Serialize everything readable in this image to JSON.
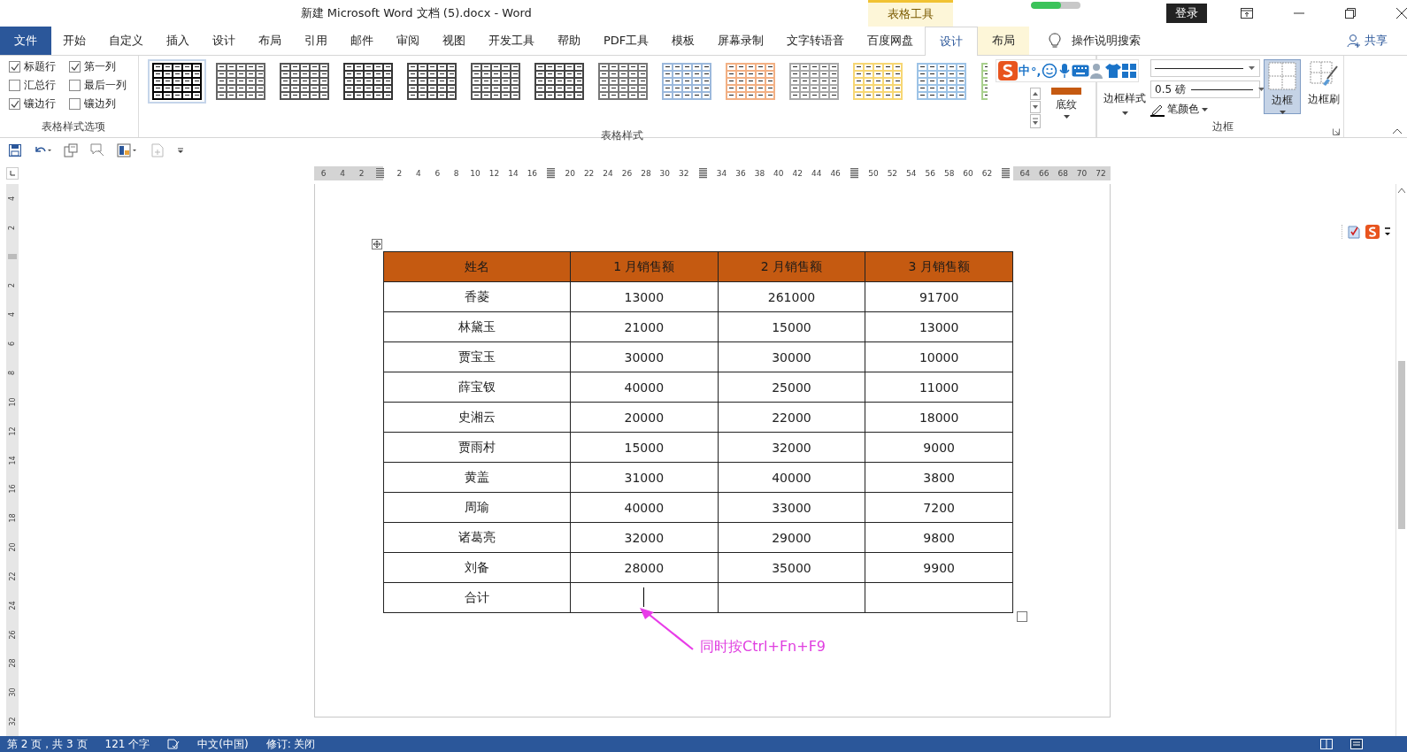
{
  "window": {
    "title": "新建 Microsoft Word 文档 (5).docx  -  Word",
    "context_group": "表格工具",
    "sync_progress": {
      "level": 0.6
    },
    "sign_in": "登录"
  },
  "ribbon_tabs": [
    {
      "label": "文件",
      "kind": "file",
      "selected": false
    },
    {
      "label": "开始",
      "kind": "normal",
      "selected": false
    },
    {
      "label": "自定义",
      "kind": "normal",
      "selected": false
    },
    {
      "label": "插入",
      "kind": "normal",
      "selected": false
    },
    {
      "label": "设计",
      "kind": "normal",
      "selected": false
    },
    {
      "label": "布局",
      "kind": "normal",
      "selected": false
    },
    {
      "label": "引用",
      "kind": "normal",
      "selected": false
    },
    {
      "label": "邮件",
      "kind": "normal",
      "selected": false
    },
    {
      "label": "审阅",
      "kind": "normal",
      "selected": false
    },
    {
      "label": "视图",
      "kind": "normal",
      "selected": false
    },
    {
      "label": "开发工具",
      "kind": "normal",
      "selected": false
    },
    {
      "label": "帮助",
      "kind": "normal",
      "selected": false
    },
    {
      "label": "PDF工具",
      "kind": "normal",
      "selected": false
    },
    {
      "label": "模板",
      "kind": "normal",
      "selected": false
    },
    {
      "label": "屏幕录制",
      "kind": "normal",
      "selected": false
    },
    {
      "label": "文字转语音",
      "kind": "normal",
      "selected": false
    },
    {
      "label": "百度网盘",
      "kind": "normal",
      "selected": false
    },
    {
      "label": "设计",
      "kind": "context",
      "selected": true
    },
    {
      "label": "布局",
      "kind": "context",
      "selected": false
    }
  ],
  "tell_me": "操作说明搜索",
  "share": "共享",
  "style_options": {
    "title": "表格样式选项",
    "options": [
      {
        "label": "标题行",
        "checked": true
      },
      {
        "label": "第一列",
        "checked": true
      },
      {
        "label": "汇总行",
        "checked": false
      },
      {
        "label": "最后一列",
        "checked": false
      },
      {
        "label": "镶边行",
        "checked": true
      },
      {
        "label": "镶边列",
        "checked": false
      }
    ]
  },
  "table_styles": {
    "title": "表格样式",
    "styles": [
      {
        "color": "#000000",
        "selected": true
      },
      {
        "color": "#666666",
        "selected": false
      },
      {
        "color": "#555555",
        "selected": false
      },
      {
        "color": "#333333",
        "selected": false
      },
      {
        "color": "#444444",
        "selected": false
      },
      {
        "color": "#555555",
        "selected": false
      },
      {
        "color": "#444444",
        "selected": false
      },
      {
        "color": "#777777",
        "selected": false
      },
      {
        "color": "#9cb9dc",
        "selected": false
      },
      {
        "color": "#f2b084",
        "selected": false
      },
      {
        "color": "#aaaaaa",
        "selected": false
      },
      {
        "color": "#f7d774",
        "selected": false
      },
      {
        "color": "#9dc3e6",
        "selected": false
      },
      {
        "color": "#a9d08e",
        "selected": false
      }
    ]
  },
  "shading": {
    "label": "底纹",
    "color": "#c55a11"
  },
  "borders": {
    "title": "边框",
    "border_styles": "边框样式",
    "pen_weight": "0.5 磅",
    "pen_color": "笔颜色",
    "border": {
      "label": "边框",
      "selected": true
    },
    "border_painter": "边框刷"
  },
  "ime_toolbar": {
    "mode": "中",
    "punctuation": "°,"
  },
  "ruler": {
    "horizontal": [
      {
        "kind": "num",
        "label": "6"
      },
      {
        "kind": "num",
        "label": "4"
      },
      {
        "kind": "num",
        "label": "2"
      },
      {
        "kind": "marker"
      },
      {
        "kind": "num",
        "label": "2"
      },
      {
        "kind": "num",
        "label": "4"
      },
      {
        "kind": "num",
        "label": "6"
      },
      {
        "kind": "num",
        "label": "8"
      },
      {
        "kind": "num",
        "label": "10"
      },
      {
        "kind": "num",
        "label": "12"
      },
      {
        "kind": "num",
        "label": "14"
      },
      {
        "kind": "num",
        "label": "16"
      },
      {
        "kind": "marker"
      },
      {
        "kind": "num",
        "label": "20"
      },
      {
        "kind": "num",
        "label": "22"
      },
      {
        "kind": "num",
        "label": "24"
      },
      {
        "kind": "num",
        "label": "26"
      },
      {
        "kind": "num",
        "label": "28"
      },
      {
        "kind": "num",
        "label": "30"
      },
      {
        "kind": "num",
        "label": "32"
      },
      {
        "kind": "marker"
      },
      {
        "kind": "num",
        "label": "34"
      },
      {
        "kind": "num",
        "label": "36"
      },
      {
        "kind": "num",
        "label": "38"
      },
      {
        "kind": "num",
        "label": "40"
      },
      {
        "kind": "num",
        "label": "42"
      },
      {
        "kind": "num",
        "label": "44"
      },
      {
        "kind": "num",
        "label": "46"
      },
      {
        "kind": "marker"
      },
      {
        "kind": "num",
        "label": "50"
      },
      {
        "kind": "num",
        "label": "52"
      },
      {
        "kind": "num",
        "label": "54"
      },
      {
        "kind": "num",
        "label": "56"
      },
      {
        "kind": "num",
        "label": "58"
      },
      {
        "kind": "num",
        "label": "60"
      },
      {
        "kind": "num",
        "label": "62"
      },
      {
        "kind": "marker"
      },
      {
        "kind": "num",
        "label": "64"
      },
      {
        "kind": "num",
        "label": "66"
      },
      {
        "kind": "num",
        "label": "68"
      },
      {
        "kind": "num",
        "label": "70"
      },
      {
        "kind": "num",
        "label": "72"
      }
    ],
    "vertical": [
      {
        "kind": "num",
        "label": "4"
      },
      {
        "kind": "num",
        "label": "2"
      },
      {
        "kind": "marker"
      },
      {
        "kind": "num",
        "label": "2"
      },
      {
        "kind": "num",
        "label": "4"
      },
      {
        "kind": "num",
        "label": "6"
      },
      {
        "kind": "num",
        "label": "8"
      },
      {
        "kind": "num",
        "label": "10"
      },
      {
        "kind": "num",
        "label": "12"
      },
      {
        "kind": "num",
        "label": "14"
      },
      {
        "kind": "num",
        "label": "16"
      },
      {
        "kind": "num",
        "label": "18"
      },
      {
        "kind": "num",
        "label": "20"
      },
      {
        "kind": "num",
        "label": "22"
      },
      {
        "kind": "num",
        "label": "24"
      },
      {
        "kind": "num",
        "label": "26"
      },
      {
        "kind": "num",
        "label": "28"
      },
      {
        "kind": "num",
        "label": "30"
      },
      {
        "kind": "num",
        "label": "32"
      }
    ]
  },
  "table": {
    "columns": [
      "姓名",
      "1 月销售额",
      "2 月销售额",
      "3 月销售额"
    ],
    "rows": [
      [
        "香菱",
        "13000",
        "261000",
        "91700"
      ],
      [
        "林黛玉",
        "21000",
        "15000",
        "13000"
      ],
      [
        "贾宝玉",
        "30000",
        "30000",
        "10000"
      ],
      [
        "薛宝钗",
        "40000",
        "25000",
        "11000"
      ],
      [
        "史湘云",
        "20000",
        "22000",
        "18000"
      ],
      [
        "贾雨村",
        "15000",
        "32000",
        "9000"
      ],
      [
        "黄盖",
        "31000",
        "40000",
        "3800"
      ],
      [
        "周瑜",
        "40000",
        "33000",
        "7200"
      ],
      [
        "诸葛亮",
        "32000",
        "29000",
        "9800"
      ],
      [
        "刘备",
        "28000",
        "35000",
        "9900"
      ],
      [
        "合计",
        "",
        "",
        ""
      ]
    ]
  },
  "annotation": "同时按Ctrl+Fn+F9",
  "status_bar": [
    "第 2 页，共 3 页",
    "121 个字",
    "中文(中国)",
    "修订: 关闭"
  ]
}
